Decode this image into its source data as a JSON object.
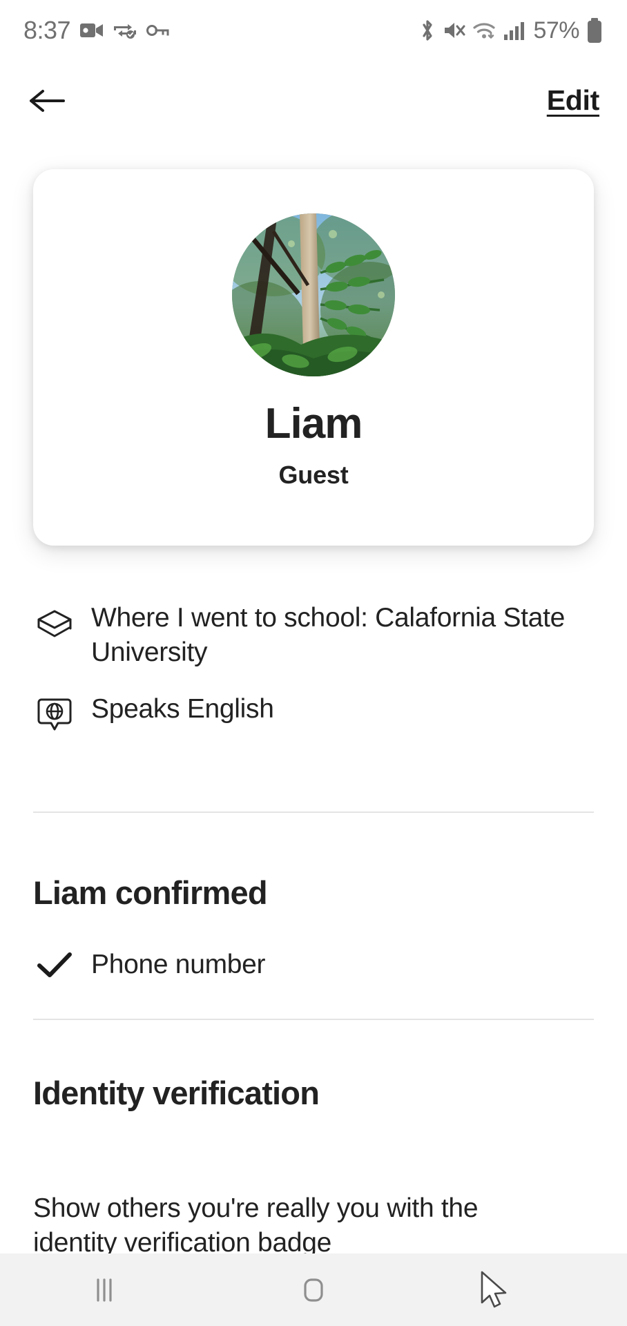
{
  "status_bar": {
    "time": "8:37",
    "battery_percent": "57%",
    "left_icons": [
      "camera-icon",
      "screen-share-icon",
      "vpn-key-icon"
    ],
    "right_icons": [
      "bluetooth-icon",
      "mute-icon",
      "wifi-icon",
      "cellular-signal-icon",
      "battery-icon"
    ]
  },
  "header": {
    "back_label": "Back",
    "edit_label": "Edit"
  },
  "profile": {
    "name": "Liam",
    "role": "Guest",
    "avatar_alt": "forest-photo-avatar"
  },
  "info": [
    {
      "icon": "graduation-cap-icon",
      "text": "Where I went to school: Calafornia State University"
    },
    {
      "icon": "speech-bubble-globe-icon",
      "text": "Speaks English"
    }
  ],
  "confirmed_section": {
    "title": "Liam confirmed",
    "items": [
      {
        "icon": "check-icon",
        "label": "Phone number"
      }
    ]
  },
  "identity_section": {
    "title": "Identity verification",
    "description": "Show others you're really you with the identity verification badge"
  },
  "nav_bar": {
    "recents_label": "Recents",
    "home_label": "Home",
    "back_label": "Back"
  },
  "colors": {
    "text_primary": "#222222",
    "status_gray": "#707070",
    "divider": "#e4e4e4",
    "nav_background": "#f2f2f2"
  }
}
